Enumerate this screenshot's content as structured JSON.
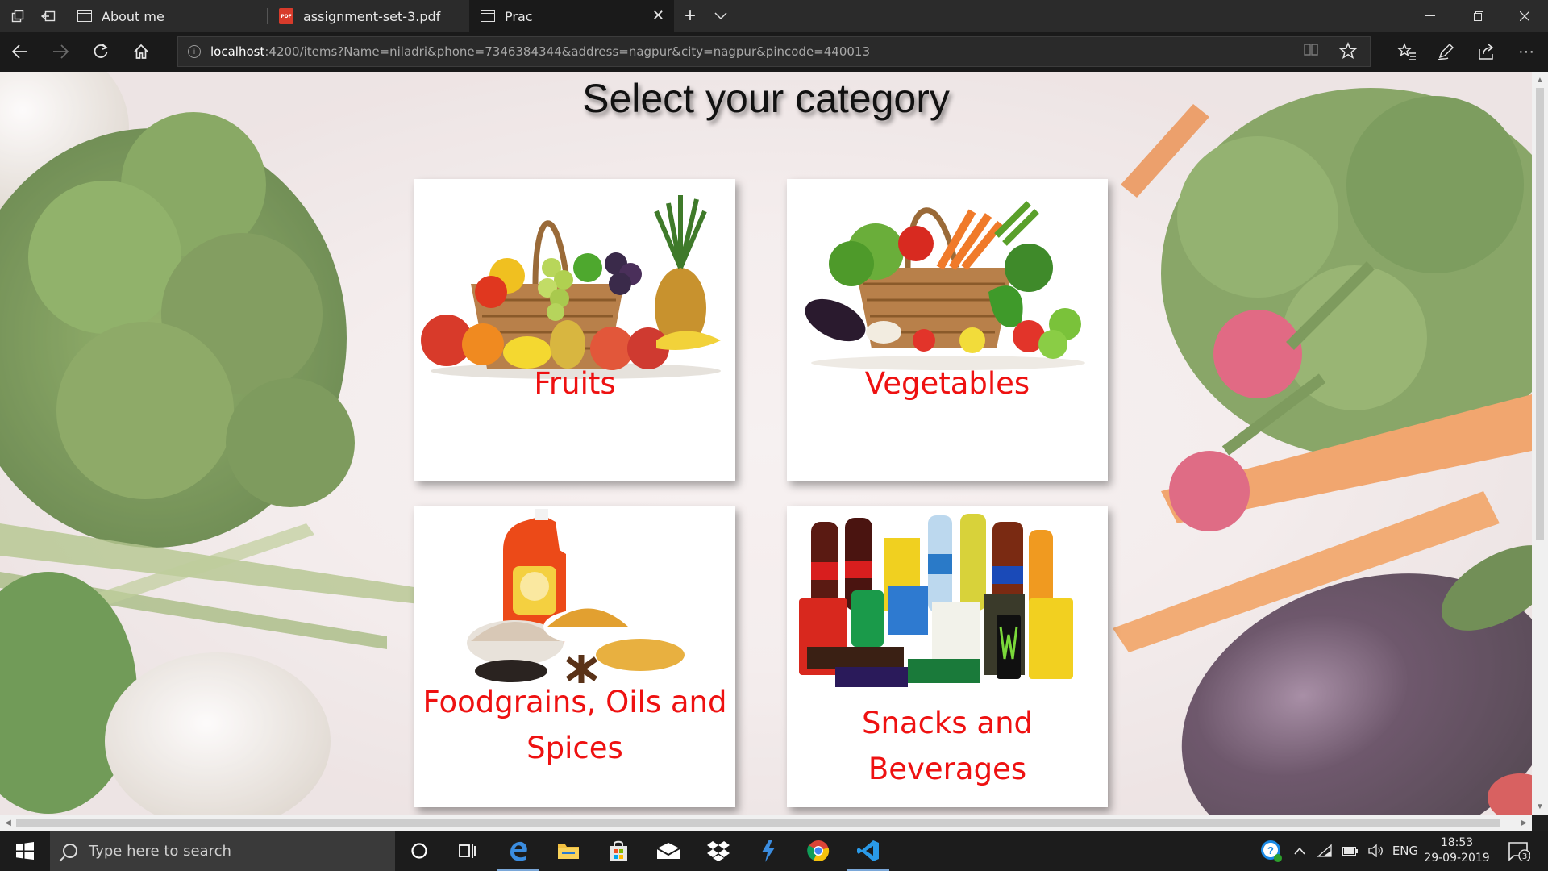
{
  "browser": {
    "tabs": [
      {
        "title": "About me",
        "icon": "page-icon",
        "active": false
      },
      {
        "title": "assignment-set-3.pdf",
        "icon": "pdf-icon",
        "active": false
      },
      {
        "title": "Prac",
        "icon": "page-icon",
        "active": true
      }
    ],
    "url_host": "localhost",
    "url_rest": ":4200/items?Name=niladri&phone=7346384344&address=nagpur&city=nagpur&pincode=440013"
  },
  "page": {
    "title": "Select your category",
    "categories": [
      {
        "label": "Fruits",
        "image": "fruit-basket-image"
      },
      {
        "label": "Vegetables",
        "image": "vegetable-basket-image"
      },
      {
        "label": "Foodgrains, Oils and Spices",
        "image": "foodgrains-oil-image"
      },
      {
        "label": "Snacks and Beverages",
        "image": "snacks-beverages-image"
      }
    ]
  },
  "taskbar": {
    "search_placeholder": "Type here to search",
    "language": "ENG",
    "time": "18:53",
    "date": "29-09-2019",
    "notifications": "3"
  },
  "colors": {
    "category_label": "#ee1111",
    "chrome_dark": "#2b2b2b"
  }
}
